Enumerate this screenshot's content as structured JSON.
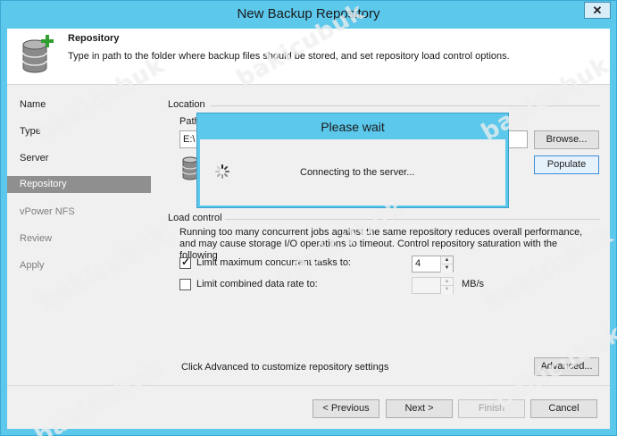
{
  "window": {
    "title": "New Backup Repository",
    "close_label": "✕"
  },
  "header": {
    "title": "Repository",
    "description": "Type in path to the folder where backup files should be stored, and set repository load control options.",
    "icon": "database-add-icon"
  },
  "steps": [
    {
      "label": "Name",
      "state": "done"
    },
    {
      "label": "Type",
      "state": "done"
    },
    {
      "label": "Server",
      "state": "done"
    },
    {
      "label": "Repository",
      "state": "active"
    },
    {
      "label": "vPower NFS",
      "state": "todo"
    },
    {
      "label": "Review",
      "state": "todo"
    },
    {
      "label": "Apply",
      "state": "todo"
    }
  ],
  "location": {
    "section_label": "Location",
    "path_label": "Path",
    "path_value": "E:\\",
    "browse_label": "Browse...",
    "populate_label": "Populate"
  },
  "load_control": {
    "section_label": "Load control",
    "description": "Running too many concurrent jobs against the same repository reduces overall performance, and may cause storage I/O operations to timeout. Control repository saturation with the following",
    "limit_tasks_label": "Limit maximum concurrent tasks to:",
    "limit_tasks_checked": true,
    "limit_tasks_value": "4",
    "limit_rate_label": "Limit combined data rate to:",
    "limit_rate_checked": false,
    "limit_rate_value": "",
    "rate_unit": "MB/s"
  },
  "advanced": {
    "hint": "Click Advanced to customize repository settings",
    "button_label": "Advanced..."
  },
  "footer": {
    "previous_label": "< Previous",
    "next_label": "Next >",
    "finish_label": "Finish",
    "cancel_label": "Cancel"
  },
  "dialog": {
    "title": "Please wait",
    "message": "Connecting to the server..."
  },
  "watermark_text": "bakicubuk",
  "colors": {
    "accent": "#5bc8ec",
    "active_step": "#8f8f8f",
    "plus": "#2e9e2e"
  }
}
